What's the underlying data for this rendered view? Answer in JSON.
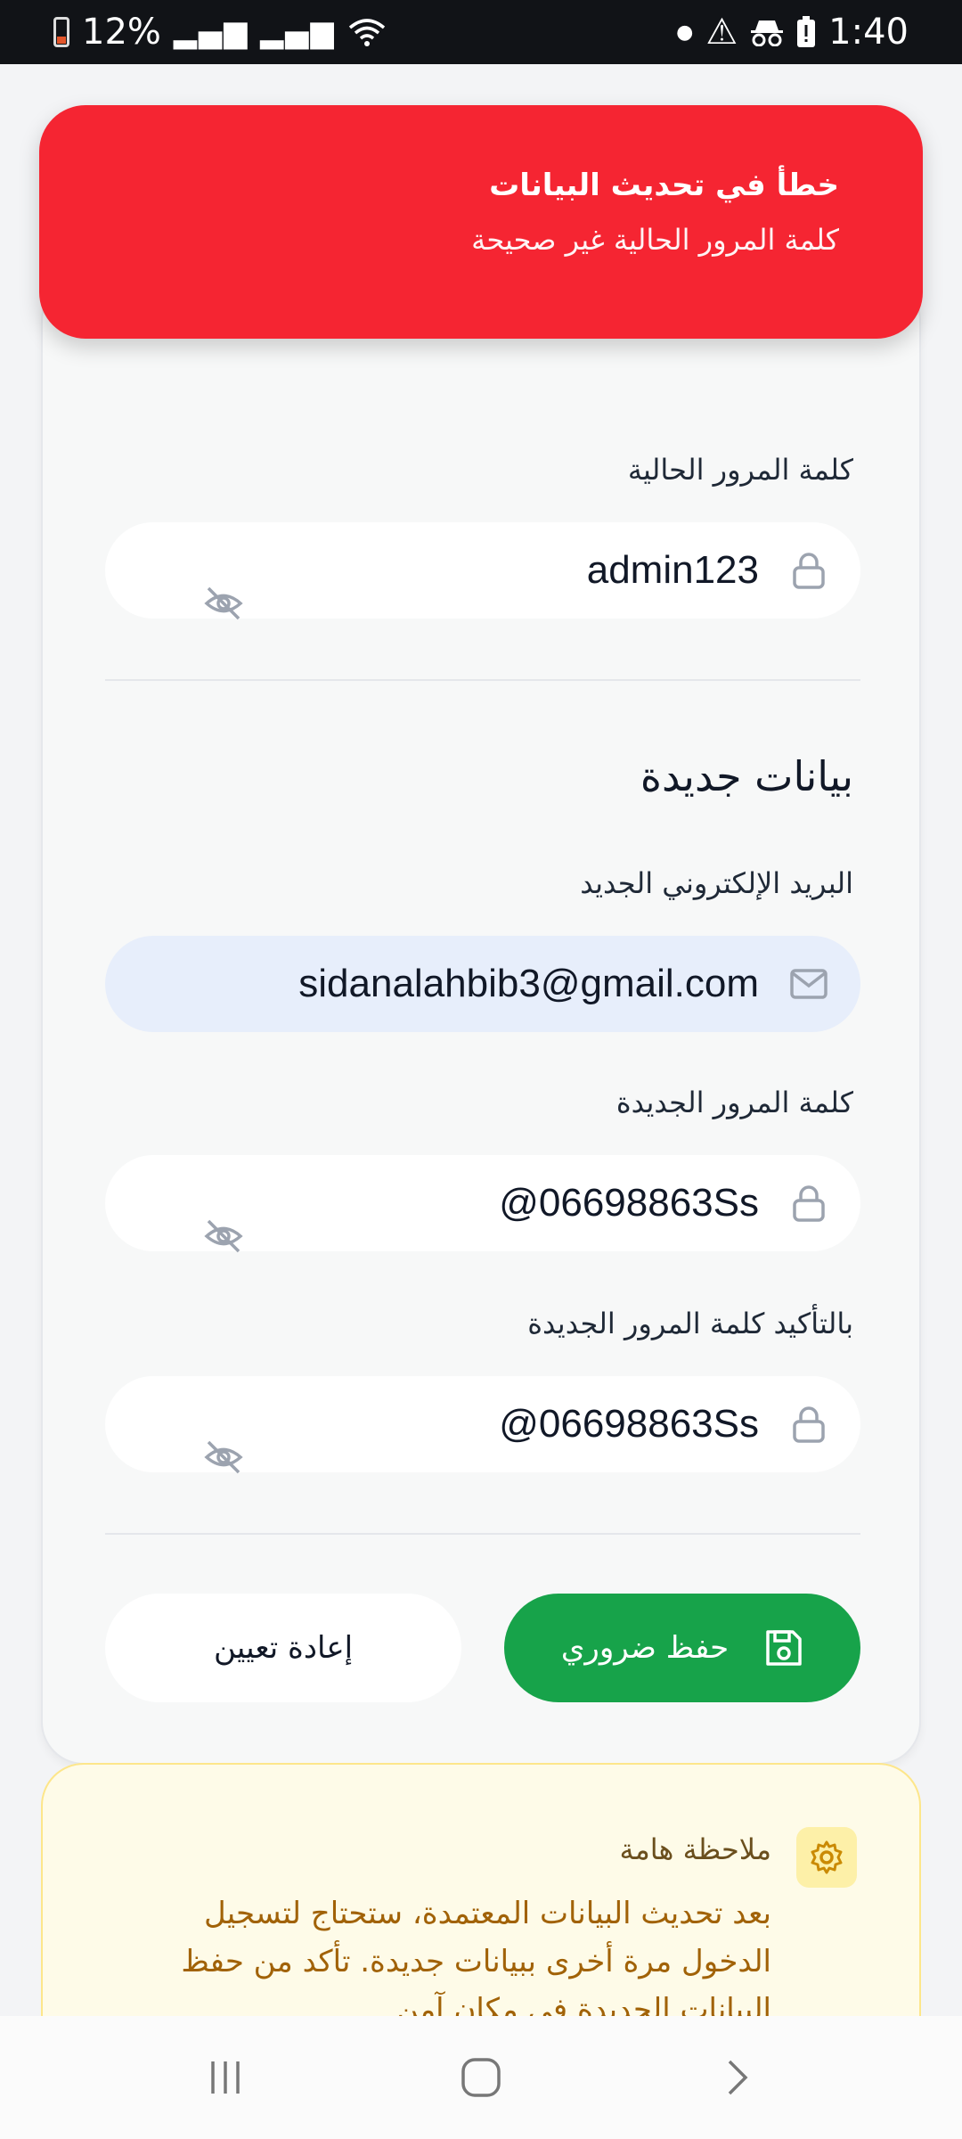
{
  "status_bar": {
    "battery": "12%",
    "time": "1:40"
  },
  "error_toast": {
    "title": "خطأ في تحديث البيانات",
    "message": "كلمة المرور الحالية غير صحيحة"
  },
  "form": {
    "current_password_label": "كلمة المرور الحالية",
    "current_password_value": "admin123",
    "new_data_title": "بيانات جديدة",
    "new_email_label": "البريد الإلكتروني الجديد",
    "new_email_value": "sidanalahbib3@gmail.com",
    "new_password_label": "كلمة المرور الجديدة",
    "new_password_value": "@06698863Ss",
    "confirm_password_label": "بالتأكيد كلمة المرور الجديدة",
    "confirm_password_value": "@06698863Ss",
    "save_button": "حفظ ضروري",
    "reset_button": "إعادة تعيين"
  },
  "note": {
    "title": "ملاحظة هامة",
    "text": "بعد تحديث البيانات المعتمدة، ستحتاج لتسجيل الدخول مرة أخرى ببيانات جديدة. تأكد من حفظ البيانات الجديدة في مكان آمن"
  },
  "colors": {
    "error": "#f52532",
    "save": "#17a34a",
    "note_bg": "#fefbe8",
    "note_text": "#a16207"
  }
}
